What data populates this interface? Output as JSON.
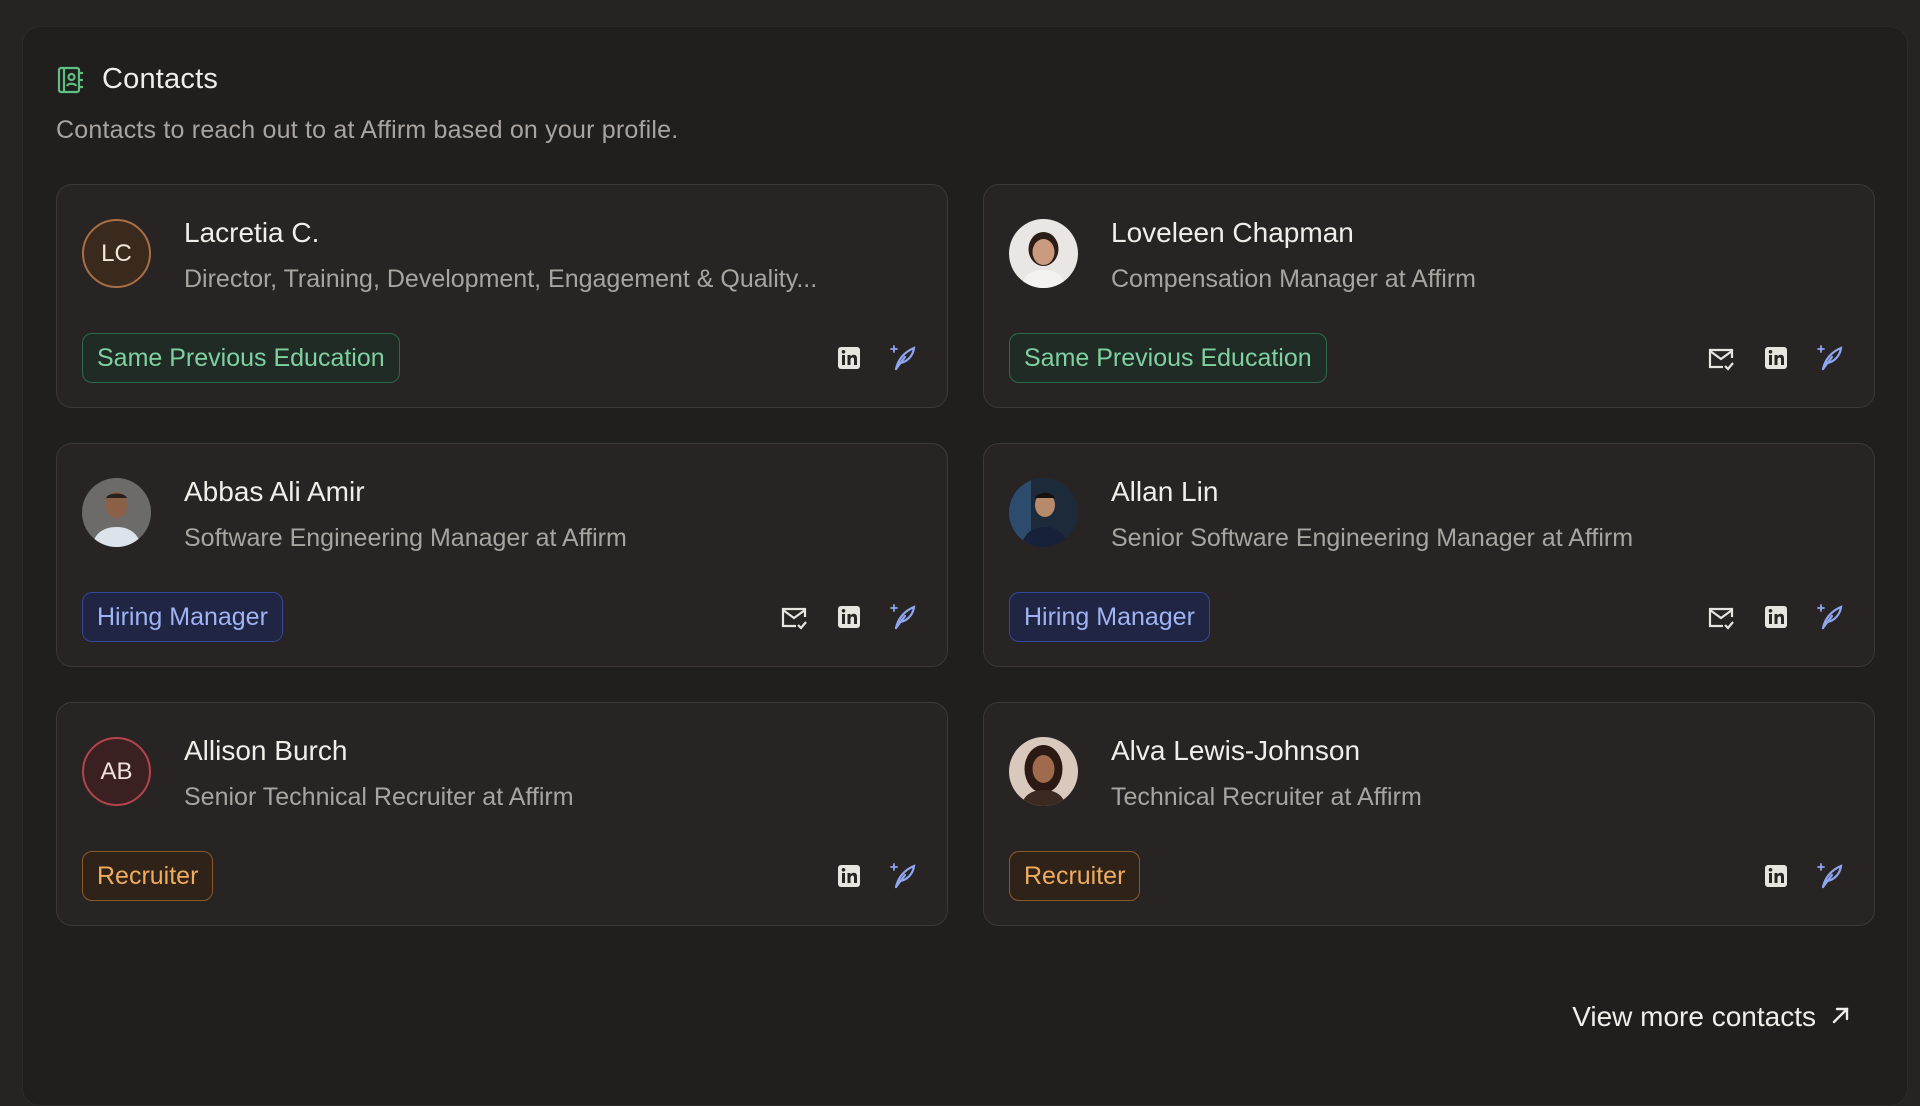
{
  "header": {
    "title": "Contacts",
    "subtitle": "Contacts to reach out to at Affirm based on your profile.",
    "icon": "contact-book-icon"
  },
  "colors": {
    "education_tag": "#7fd1a2",
    "hiring_manager_tag": "#9fb3f5",
    "recruiter_tag": "#f0ac5e",
    "ai_icon": "#8fa6f0"
  },
  "contacts": [
    {
      "name": "Lacretia C.",
      "role": "Director, Training, Development, Engagement & Quality...",
      "avatar_initials": "LC",
      "tag": "Same Previous Education",
      "actions": [
        "linkedin-icon",
        "ai-quill-icon"
      ]
    },
    {
      "name": "Loveleen Chapman",
      "role": "Compensation Manager at Affirm",
      "avatar_initials": "",
      "tag": "Same Previous Education",
      "actions": [
        "email-icon",
        "linkedin-icon",
        "ai-quill-icon"
      ]
    },
    {
      "name": "Abbas Ali Amir",
      "role": "Software Engineering Manager at Affirm",
      "avatar_initials": "",
      "tag": "Hiring Manager",
      "actions": [
        "email-icon",
        "linkedin-icon",
        "ai-quill-icon"
      ]
    },
    {
      "name": "Allan Lin",
      "role": "Senior Software Engineering Manager at Affirm",
      "avatar_initials": "",
      "tag": "Hiring Manager",
      "actions": [
        "email-icon",
        "linkedin-icon",
        "ai-quill-icon"
      ]
    },
    {
      "name": "Allison Burch",
      "role": "Senior Technical Recruiter at Affirm",
      "avatar_initials": "AB",
      "tag": "Recruiter",
      "actions": [
        "linkedin-icon",
        "ai-quill-icon"
      ]
    },
    {
      "name": "Alva Lewis-Johnson",
      "role": "Technical Recruiter at Affirm",
      "avatar_initials": "",
      "tag": "Recruiter",
      "actions": [
        "linkedin-icon",
        "ai-quill-icon"
      ]
    }
  ],
  "footer": {
    "view_more_label": "View more contacts",
    "view_more_icon": "arrow-up-right-icon"
  }
}
